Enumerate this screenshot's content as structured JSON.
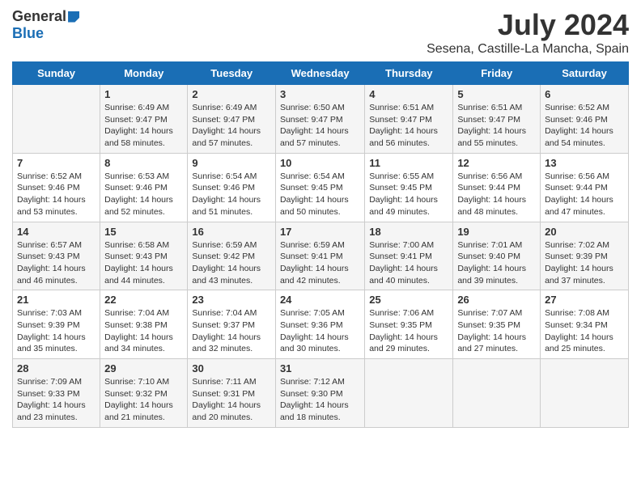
{
  "header": {
    "logo_general": "General",
    "logo_blue": "Blue",
    "title": "July 2024",
    "location": "Sesena, Castille-La Mancha, Spain"
  },
  "weekdays": [
    "Sunday",
    "Monday",
    "Tuesday",
    "Wednesday",
    "Thursday",
    "Friday",
    "Saturday"
  ],
  "weeks": [
    [
      {
        "day": "",
        "info": ""
      },
      {
        "day": "1",
        "info": "Sunrise: 6:49 AM\nSunset: 9:47 PM\nDaylight: 14 hours\nand 58 minutes."
      },
      {
        "day": "2",
        "info": "Sunrise: 6:49 AM\nSunset: 9:47 PM\nDaylight: 14 hours\nand 57 minutes."
      },
      {
        "day": "3",
        "info": "Sunrise: 6:50 AM\nSunset: 9:47 PM\nDaylight: 14 hours\nand 57 minutes."
      },
      {
        "day": "4",
        "info": "Sunrise: 6:51 AM\nSunset: 9:47 PM\nDaylight: 14 hours\nand 56 minutes."
      },
      {
        "day": "5",
        "info": "Sunrise: 6:51 AM\nSunset: 9:47 PM\nDaylight: 14 hours\nand 55 minutes."
      },
      {
        "day": "6",
        "info": "Sunrise: 6:52 AM\nSunset: 9:46 PM\nDaylight: 14 hours\nand 54 minutes."
      }
    ],
    [
      {
        "day": "7",
        "info": "Sunrise: 6:52 AM\nSunset: 9:46 PM\nDaylight: 14 hours\nand 53 minutes."
      },
      {
        "day": "8",
        "info": "Sunrise: 6:53 AM\nSunset: 9:46 PM\nDaylight: 14 hours\nand 52 minutes."
      },
      {
        "day": "9",
        "info": "Sunrise: 6:54 AM\nSunset: 9:46 PM\nDaylight: 14 hours\nand 51 minutes."
      },
      {
        "day": "10",
        "info": "Sunrise: 6:54 AM\nSunset: 9:45 PM\nDaylight: 14 hours\nand 50 minutes."
      },
      {
        "day": "11",
        "info": "Sunrise: 6:55 AM\nSunset: 9:45 PM\nDaylight: 14 hours\nand 49 minutes."
      },
      {
        "day": "12",
        "info": "Sunrise: 6:56 AM\nSunset: 9:44 PM\nDaylight: 14 hours\nand 48 minutes."
      },
      {
        "day": "13",
        "info": "Sunrise: 6:56 AM\nSunset: 9:44 PM\nDaylight: 14 hours\nand 47 minutes."
      }
    ],
    [
      {
        "day": "14",
        "info": "Sunrise: 6:57 AM\nSunset: 9:43 PM\nDaylight: 14 hours\nand 46 minutes."
      },
      {
        "day": "15",
        "info": "Sunrise: 6:58 AM\nSunset: 9:43 PM\nDaylight: 14 hours\nand 44 minutes."
      },
      {
        "day": "16",
        "info": "Sunrise: 6:59 AM\nSunset: 9:42 PM\nDaylight: 14 hours\nand 43 minutes."
      },
      {
        "day": "17",
        "info": "Sunrise: 6:59 AM\nSunset: 9:41 PM\nDaylight: 14 hours\nand 42 minutes."
      },
      {
        "day": "18",
        "info": "Sunrise: 7:00 AM\nSunset: 9:41 PM\nDaylight: 14 hours\nand 40 minutes."
      },
      {
        "day": "19",
        "info": "Sunrise: 7:01 AM\nSunset: 9:40 PM\nDaylight: 14 hours\nand 39 minutes."
      },
      {
        "day": "20",
        "info": "Sunrise: 7:02 AM\nSunset: 9:39 PM\nDaylight: 14 hours\nand 37 minutes."
      }
    ],
    [
      {
        "day": "21",
        "info": "Sunrise: 7:03 AM\nSunset: 9:39 PM\nDaylight: 14 hours\nand 35 minutes."
      },
      {
        "day": "22",
        "info": "Sunrise: 7:04 AM\nSunset: 9:38 PM\nDaylight: 14 hours\nand 34 minutes."
      },
      {
        "day": "23",
        "info": "Sunrise: 7:04 AM\nSunset: 9:37 PM\nDaylight: 14 hours\nand 32 minutes."
      },
      {
        "day": "24",
        "info": "Sunrise: 7:05 AM\nSunset: 9:36 PM\nDaylight: 14 hours\nand 30 minutes."
      },
      {
        "day": "25",
        "info": "Sunrise: 7:06 AM\nSunset: 9:35 PM\nDaylight: 14 hours\nand 29 minutes."
      },
      {
        "day": "26",
        "info": "Sunrise: 7:07 AM\nSunset: 9:35 PM\nDaylight: 14 hours\nand 27 minutes."
      },
      {
        "day": "27",
        "info": "Sunrise: 7:08 AM\nSunset: 9:34 PM\nDaylight: 14 hours\nand 25 minutes."
      }
    ],
    [
      {
        "day": "28",
        "info": "Sunrise: 7:09 AM\nSunset: 9:33 PM\nDaylight: 14 hours\nand 23 minutes."
      },
      {
        "day": "29",
        "info": "Sunrise: 7:10 AM\nSunset: 9:32 PM\nDaylight: 14 hours\nand 21 minutes."
      },
      {
        "day": "30",
        "info": "Sunrise: 7:11 AM\nSunset: 9:31 PM\nDaylight: 14 hours\nand 20 minutes."
      },
      {
        "day": "31",
        "info": "Sunrise: 7:12 AM\nSunset: 9:30 PM\nDaylight: 14 hours\nand 18 minutes."
      },
      {
        "day": "",
        "info": ""
      },
      {
        "day": "",
        "info": ""
      },
      {
        "day": "",
        "info": ""
      }
    ]
  ]
}
